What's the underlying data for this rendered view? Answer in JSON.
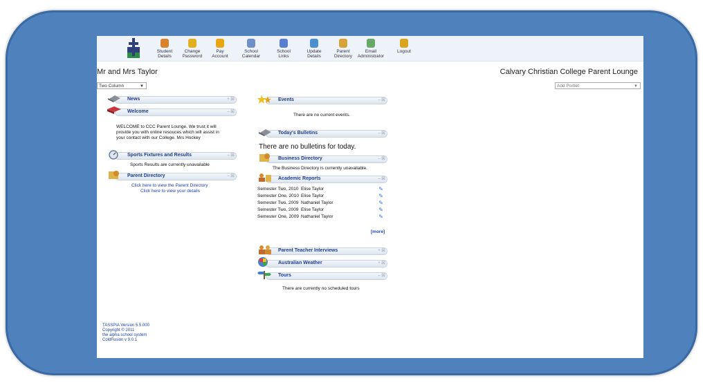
{
  "nav": [
    {
      "label1": "Student",
      "label2": "Details",
      "icon": "student-icon",
      "color": "#d9822b"
    },
    {
      "label1": "Change",
      "label2": "Password",
      "icon": "key-icon",
      "color": "#e0b020"
    },
    {
      "label1": "Pay",
      "label2": "Account",
      "icon": "money-icon",
      "color": "#e8a614"
    },
    {
      "label1": "School",
      "label2": "Calendar",
      "icon": "calendar-icon",
      "color": "#6f8fc9"
    },
    {
      "label1": "School",
      "label2": "Links",
      "icon": "link-icon",
      "color": "#5a7fcf"
    },
    {
      "label1": "Update",
      "label2": "Details",
      "icon": "update-icon",
      "color": "#4b8fcf"
    },
    {
      "label1": "Parent",
      "label2": "Directory",
      "icon": "directory-icon",
      "color": "#d6a33a"
    },
    {
      "label1": "Email",
      "label2": "Administrator",
      "icon": "email-icon",
      "color": "#6aa86a"
    },
    {
      "label1": "Logout",
      "label2": "",
      "icon": "logout-icon",
      "color": "#d9a520"
    }
  ],
  "user_name": "Mr and Mrs Taylor",
  "site_title": "Calvary Christian College Parent Lounge",
  "layout_select": "Two Column",
  "add_portlet": "Add Portlet",
  "left": {
    "news": "News",
    "welcome": "Welcome",
    "welcome_text": [
      "WELCOME to CCC Parent Lounge. We trust it will",
      "provide you with online resouces which will assist in",
      "your contact with our College. Mrs Hockey"
    ],
    "sports": "Sports Fixtures and Results",
    "sports_text": "Sports Results are currently unavailable",
    "parent_dir": "Parent Directory",
    "parent_link1": "Click here to view the Parent Directory",
    "parent_link2": "Click here to view your details"
  },
  "right": {
    "events": "Events",
    "events_text": "There are no current events.",
    "bulletins": "Today's Bulletins",
    "bulletins_text": "There are no bulletins for today.",
    "business": "Business Directory",
    "business_text": "The Business Directory is currently unavailable.",
    "academic": "Academic Reports",
    "reports": [
      {
        "term": "Semester Two, 2010",
        "name": "Elise Taylor"
      },
      {
        "term": "Semester One, 2010",
        "name": "Elise Taylor"
      },
      {
        "term": "Semester Two, 2009",
        "name": "Nathaniel Taylor"
      },
      {
        "term": "Semester Two, 2009",
        "name": "Elise Taylor"
      },
      {
        "term": "Semester One, 2009",
        "name": "Nathaniel Taylor"
      }
    ],
    "more": "[more]",
    "ptinterviews": "Parent Teacher Interviews",
    "weather": "Australian Weather",
    "tours": "Tours",
    "tours_text": "There are currently no scheduled tours"
  },
  "footer": [
    "TASSPIA Version 5.5.000",
    "Copyright © 2011",
    "the alpha school system",
    "ColdFusion v 9.0.1"
  ]
}
